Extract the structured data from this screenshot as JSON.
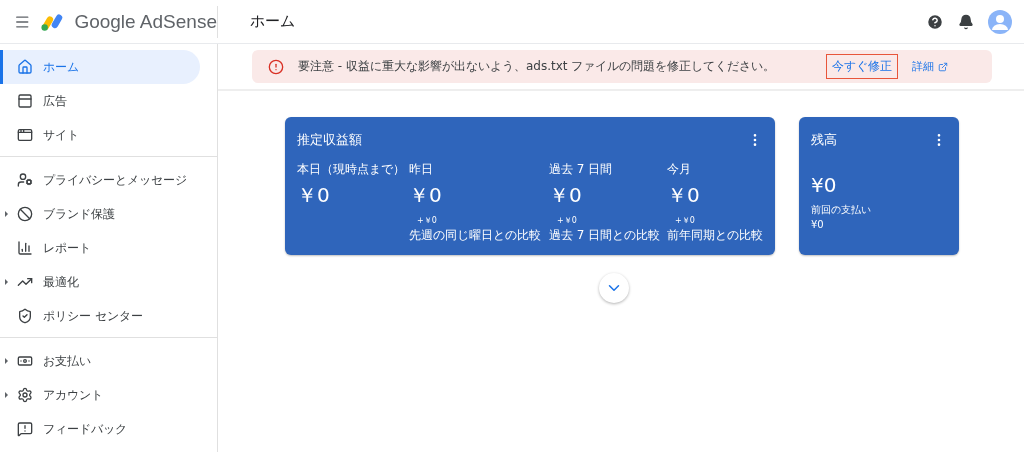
{
  "header": {
    "product": "Google AdSense",
    "page_title": "ホーム"
  },
  "sidebar": {
    "groups": [
      [
        {
          "label": "ホーム",
          "selected": true,
          "expandable": false
        },
        {
          "label": "広告",
          "selected": false,
          "expandable": false
        },
        {
          "label": "サイト",
          "selected": false,
          "expandable": false
        }
      ],
      [
        {
          "label": "プライバシーとメッセージ",
          "selected": false,
          "expandable": false
        },
        {
          "label": "ブランド保護",
          "selected": false,
          "expandable": true
        },
        {
          "label": "レポート",
          "selected": false,
          "expandable": false
        },
        {
          "label": "最適化",
          "selected": false,
          "expandable": true
        },
        {
          "label": "ポリシー センター",
          "selected": false,
          "expandable": false
        }
      ],
      [
        {
          "label": "お支払い",
          "selected": false,
          "expandable": true
        },
        {
          "label": "アカウント",
          "selected": false,
          "expandable": true
        },
        {
          "label": "フィードバック",
          "selected": false,
          "expandable": false
        }
      ]
    ]
  },
  "alert": {
    "message": "要注意 - 収益に重大な影響が出ないよう、ads.txt ファイルの問題を修正してください。",
    "fix_button": "今すぐ修正",
    "details_link": "詳細"
  },
  "earnings_card": {
    "title": "推定収益額",
    "metrics": [
      {
        "label": "本日（現時点まで）",
        "value": "￥0"
      },
      {
        "label": "昨日",
        "value": "￥0",
        "delta": "+￥0",
        "comparison": "先週の同じ曜日との比較"
      },
      {
        "label": "過去 7 日間",
        "value": "￥0",
        "delta": "+￥0",
        "comparison": "過去 7 日間との比較"
      },
      {
        "label": "今月",
        "value": "￥0",
        "delta": "+￥0",
        "comparison": "前年同期との比較"
      }
    ]
  },
  "balance_card": {
    "title": "残高",
    "value": "¥0",
    "last_payment_label": "前回の支払い",
    "last_payment_value": "¥0"
  }
}
